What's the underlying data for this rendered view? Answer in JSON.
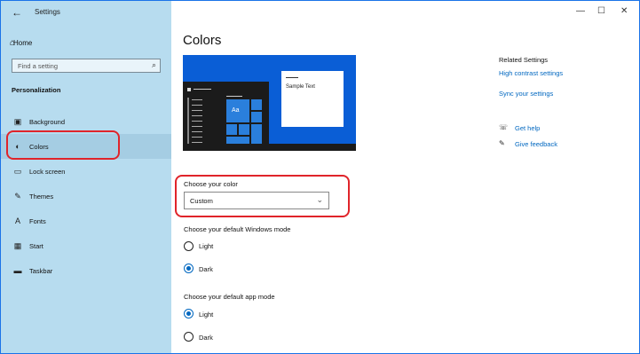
{
  "window": {
    "title": "Settings",
    "back_icon": "back-arrow-icon",
    "controls": [
      "—",
      "☐",
      "✕"
    ]
  },
  "sidebar": {
    "home": {
      "label": "Home",
      "icon": "home-icon"
    },
    "search": {
      "placeholder": "Find a setting",
      "icon": "search-icon"
    },
    "section": "Personalization",
    "items": [
      {
        "label": "Background",
        "icon": "background-icon"
      },
      {
        "label": "Colors",
        "icon": "palette-icon"
      },
      {
        "label": "Lock screen",
        "icon": "lock-screen-icon"
      },
      {
        "label": "Themes",
        "icon": "themes-icon"
      },
      {
        "label": "Fonts",
        "icon": "fonts-icon"
      },
      {
        "label": "Start",
        "icon": "start-icon"
      },
      {
        "label": "Taskbar",
        "icon": "taskbar-icon"
      }
    ],
    "selected": "Colors"
  },
  "main": {
    "title": "Colors",
    "preview": {
      "sample_text": "Sample Text",
      "tile_text": "Aa"
    },
    "choose_color": {
      "label": "Choose your color",
      "value": "Custom"
    },
    "windows_mode": {
      "label": "Choose your default Windows mode",
      "options": [
        "Light",
        "Dark"
      ],
      "selected": "Dark"
    },
    "app_mode": {
      "label": "Choose your default app mode",
      "options": [
        "Light",
        "Dark"
      ],
      "selected": "Light"
    }
  },
  "related": {
    "title": "Related Settings",
    "links": [
      "High contrast settings",
      "Sync your settings"
    ],
    "help": [
      {
        "label": "Get help",
        "icon": "help-icon"
      },
      {
        "label": "Give feedback",
        "icon": "feedback-icon"
      }
    ]
  },
  "colors": {
    "accent": "#0067c0",
    "sidebar": "#b7dcef",
    "highlight": "#e0242a"
  }
}
